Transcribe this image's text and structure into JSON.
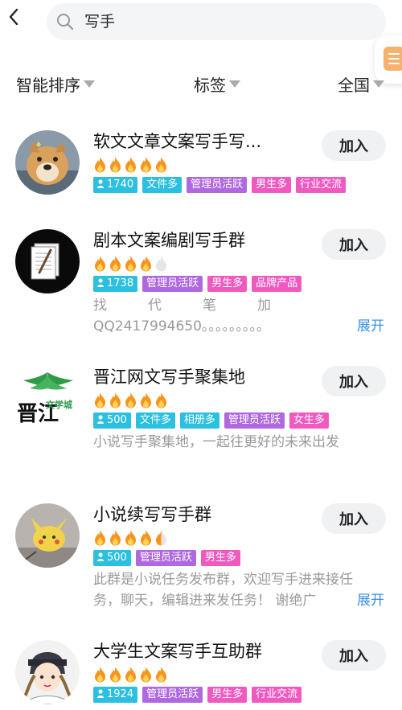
{
  "search": {
    "query": "写手"
  },
  "filters": [
    {
      "label": "智能排序"
    },
    {
      "label": "标签"
    },
    {
      "label": "全国"
    }
  ],
  "colors": {
    "tag_cyan": "#2bc0df",
    "tag_purple": "#b068e0",
    "tag_pink": "#f05ac0",
    "flame": "#f7941d",
    "expand_link": "#3b8fe6"
  },
  "groups": [
    {
      "title": "软文文章文案写手写...",
      "level": 4,
      "join_label": "加入",
      "tags": [
        {
          "text": "1740",
          "color": "cyan",
          "icon": "person-icon"
        },
        {
          "text": "文件多",
          "color": "cyan"
        },
        {
          "text": "管理员活跃",
          "color": "purple"
        },
        {
          "text": "男生多",
          "color": "pink"
        },
        {
          "text": "行业交流",
          "color": "pink"
        }
      ]
    },
    {
      "title": "剧本文案编剧写手群",
      "level": 3,
      "join_label": "加入",
      "tags": [
        {
          "text": "1738",
          "color": "cyan",
          "icon": "person-icon"
        },
        {
          "text": "管理员活跃",
          "color": "purple"
        },
        {
          "text": "男生多",
          "color": "pink"
        },
        {
          "text": "品牌产品",
          "color": "pink"
        }
      ],
      "desc_line1": "找　　　代　　　笔　　　加",
      "desc_line2": "QQ2417994650。。。。。。。。。",
      "expand_label": "展开"
    },
    {
      "title": "晋江网文写手聚集地",
      "level": 4,
      "join_label": "加入",
      "tags": [
        {
          "text": "500",
          "color": "cyan",
          "icon": "person-icon"
        },
        {
          "text": "文件多",
          "color": "cyan"
        },
        {
          "text": "相册多",
          "color": "cyan"
        },
        {
          "text": "管理员活跃",
          "color": "purple"
        },
        {
          "text": "女生多",
          "color": "pink"
        }
      ],
      "desc_line1": "小说写手聚集地，一起往更好的未来出发",
      "avatar_text": "晋江",
      "avatar_subtext": "文学城"
    },
    {
      "title": "小说续写写手群",
      "level": 4,
      "join_label": "加入",
      "tags": [
        {
          "text": "500",
          "color": "cyan",
          "icon": "person-icon"
        },
        {
          "text": "管理员活跃",
          "color": "purple"
        },
        {
          "text": "男生多",
          "color": "pink"
        }
      ],
      "desc_line1": "此群是小说任务发布群，欢迎写手进来接任",
      "desc_line2": "务，聊天，编辑进来发任务！ 谢绝广",
      "expand_label": "展开"
    },
    {
      "title": "大学生文案写手互助群",
      "level": 4,
      "join_label": "加入",
      "tags": [
        {
          "text": "1924",
          "color": "cyan",
          "icon": "person-icon"
        },
        {
          "text": "管理员活跃",
          "color": "purple"
        },
        {
          "text": "男生多",
          "color": "pink"
        },
        {
          "text": "行业交流",
          "color": "pink"
        }
      ]
    }
  ]
}
